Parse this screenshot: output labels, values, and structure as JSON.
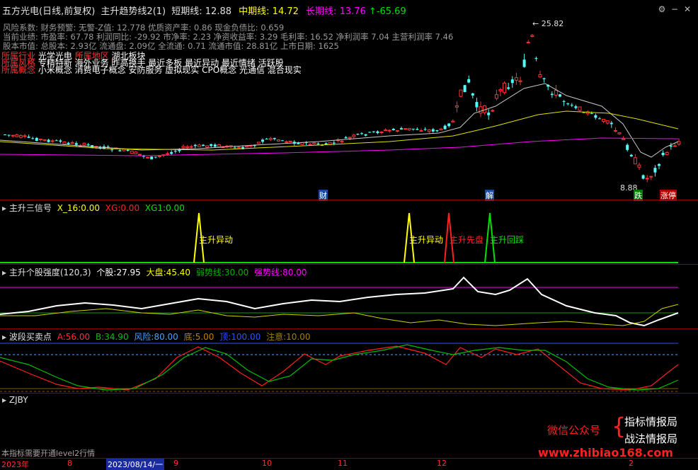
{
  "header": {
    "title": "五方光电(日线,前复权)",
    "indicator": "主升趋势线2(1)",
    "short_label": "短期线:",
    "short_val": "12.88",
    "mid_label": "中期线:",
    "mid_val": "14.72",
    "long_label": "长期线:",
    "long_val": "13.76",
    "arrow_val": "↑-65.69"
  },
  "info": {
    "line1": "风险系数: 财务预警: 无警-Z值: 12.778 优质资产率: 0.86 现金负债比: 0.659",
    "line2": "当前业绩: 市盈率: 67.78 利润同比: -29.92 市净率: 2.23 净资收益率: 3.29 毛利率: 16.52 净利润率 7.04 主营利润率 7.46",
    "line3": "股本市值: 总股本: 2.93亿 流通盘: 2.09亿 全流通: 0.71 流通市值: 28.81亿 上市日期: 1625",
    "row4_label": "所属行业",
    "row4_text": "光学光电",
    "row4_label2": "所属地区",
    "row4_text2": "湖北板块",
    "row5_label": "所属风格",
    "row5_text": "专精特新 海外业务 昨高换手 最近多板 最近异动 最近情绪 活跃股",
    "row6_label": "所属概念",
    "row6_text": "小米概念 消费电子概念 安防服务 虚拟现实 CPO概念 光通信 混合现实"
  },
  "price_chart": {
    "high_label": "25.82",
    "low_label": "8.88",
    "markers": {
      "cai": "财",
      "jie": "解",
      "die": "跌",
      "zhangting": "涨停"
    }
  },
  "panel2": {
    "title": "主升三信号",
    "x16_label": "X_16:",
    "x16_val": "0.00",
    "xg_label": "XG:",
    "xg_val": "0.00",
    "xg1_label": "XG1:",
    "xg1_val": "0.00",
    "sig1": "主升异动",
    "sig2": "主升异动",
    "sig3": "主升先盘",
    "sig4": "主升回踩"
  },
  "panel3": {
    "title": "主升个股强度(120,3)",
    "stock_label": "个股:",
    "stock_val": "27.95",
    "market_label": "大盘:",
    "market_val": "45.40",
    "weak_label": "弱势线:",
    "weak_val": "30.00",
    "strong_label": "强势线:",
    "strong_val": "80.00"
  },
  "panel4": {
    "title": "波段买卖点",
    "a_label": "A:",
    "a_val": "56.00",
    "b_label": "B:",
    "b_val": "34.90",
    "risk_label": "风险:",
    "risk_val": "80.00",
    "bottom_label": "底:",
    "bottom_val": "5.00",
    "top_label": "顶:",
    "top_val": "100.00",
    "caution_label": "注意:",
    "caution_val": "10.00"
  },
  "panel5": {
    "title": "ZJBY",
    "wechat": "微信公众号",
    "brand1": "指标情报局",
    "brand2": "战法情报局",
    "url": "www.zhibiao168.com",
    "notice": "本指标需要开通level2行情"
  },
  "axis": {
    "year": "2023年",
    "m8": "8",
    "date": "2023/08/14/一",
    "m9": "9",
    "m10": "10",
    "m11": "11",
    "m12": "12",
    "m2": "2"
  },
  "colors": {
    "up": "#ff3232",
    "down": "#54fcfc",
    "ma_white": "#cccccc",
    "ma_yellow": "#dddd00",
    "ma_magenta": "#ff00ff"
  }
}
